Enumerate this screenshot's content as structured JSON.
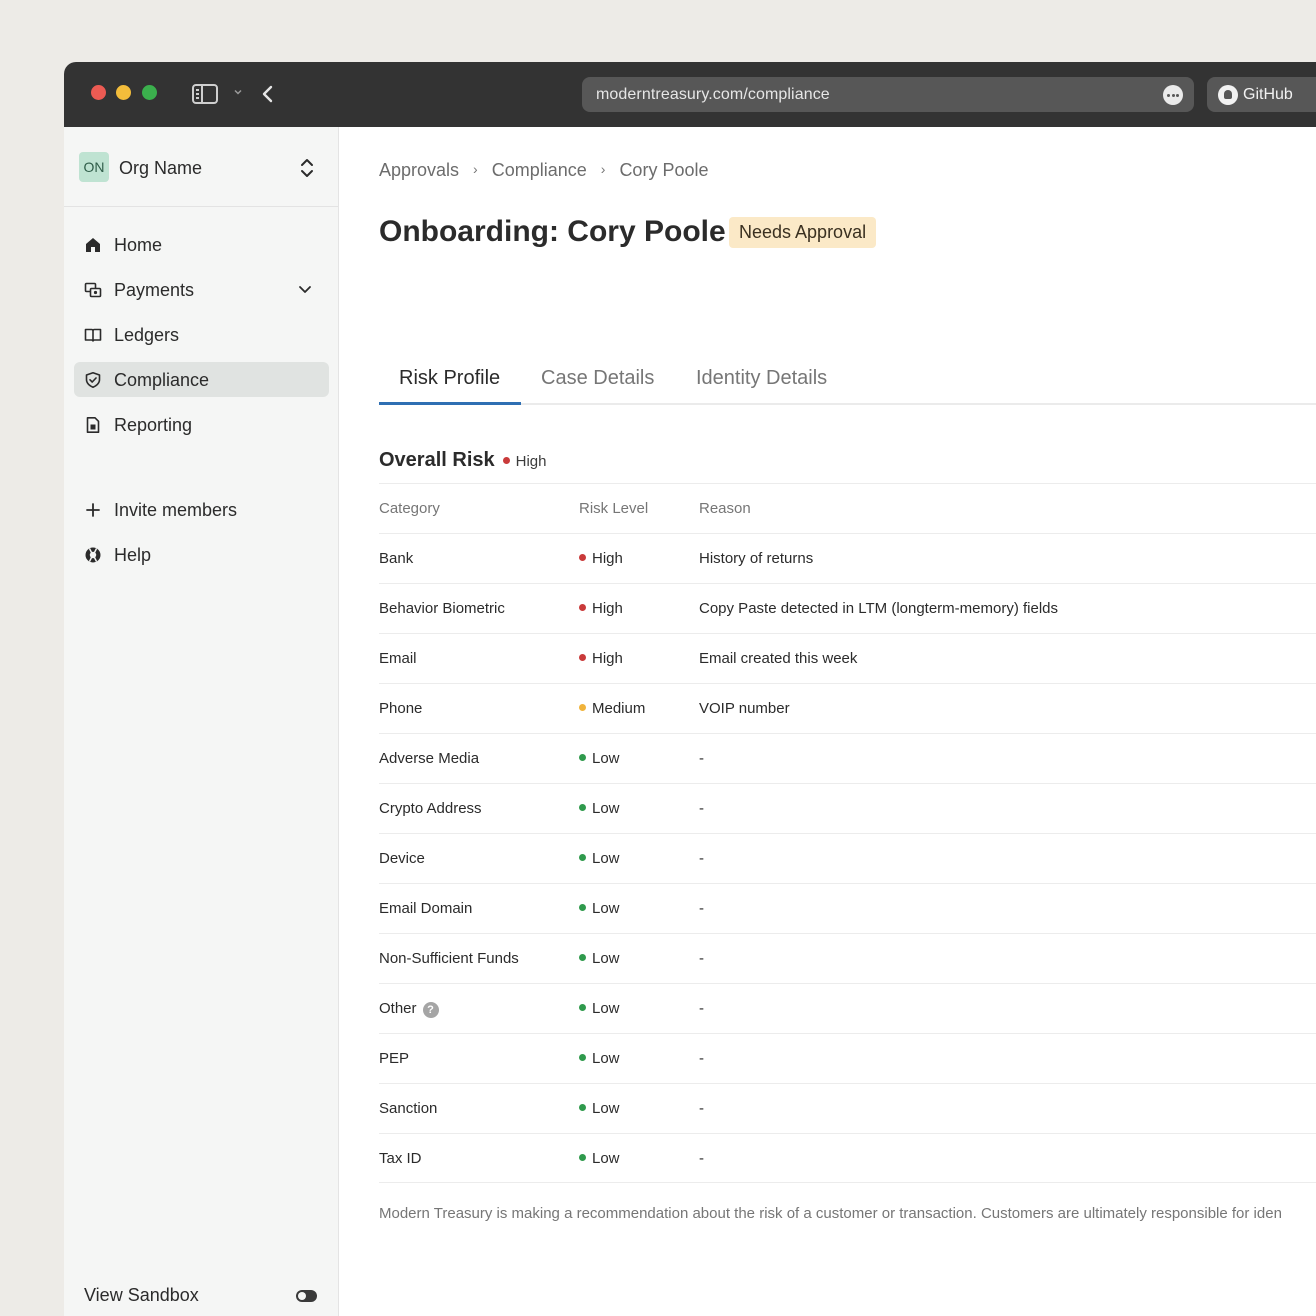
{
  "browser": {
    "url": "moderntreasury.com/compliance",
    "github_label": "GitHub"
  },
  "sidebar": {
    "org_initials": "ON",
    "org_name": "Org Name",
    "nav": [
      {
        "label": "Home",
        "icon": "home-icon"
      },
      {
        "label": "Payments",
        "icon": "payments-icon"
      },
      {
        "label": "Ledgers",
        "icon": "book-icon"
      },
      {
        "label": "Compliance",
        "icon": "shield-icon",
        "active": true
      },
      {
        "label": "Reporting",
        "icon": "report-icon"
      }
    ],
    "secondary": [
      {
        "label": "Invite members",
        "icon": "plus-icon"
      },
      {
        "label": "Help",
        "icon": "lifebuoy-icon"
      }
    ],
    "sandbox_label": "View Sandbox"
  },
  "breadcrumb": [
    "Approvals",
    "Compliance",
    "Cory Poole"
  ],
  "page": {
    "title": "Onboarding: Cory Poole",
    "status": "Needs Approval"
  },
  "tabs": [
    "Risk Profile",
    "Case Details",
    "Identity Details"
  ],
  "overall": {
    "title": "Overall Risk",
    "level": "High"
  },
  "table": {
    "headers": [
      "Category",
      "Risk Level",
      "Reason"
    ],
    "rows": [
      {
        "category": "Bank",
        "level": "High",
        "reason": "History of returns"
      },
      {
        "category": "Behavior Biometric",
        "level": "High",
        "reason": "Copy Paste detected in LTM (longterm-memory) fields"
      },
      {
        "category": "Email",
        "level": "High",
        "reason": "Email created this week"
      },
      {
        "category": "Phone",
        "level": "Medium",
        "reason": "VOIP number"
      },
      {
        "category": "Adverse Media",
        "level": "Low",
        "reason": "-"
      },
      {
        "category": "Crypto Address",
        "level": "Low",
        "reason": "-"
      },
      {
        "category": "Device",
        "level": "Low",
        "reason": "-"
      },
      {
        "category": "Email Domain",
        "level": "Low",
        "reason": "-"
      },
      {
        "category": "Non-Sufficient Funds",
        "level": "Low",
        "reason": "-"
      },
      {
        "category": "Other",
        "level": "Low",
        "reason": "-"
      },
      {
        "category": "PEP",
        "level": "Low",
        "reason": "-"
      },
      {
        "category": "Sanction",
        "level": "Low",
        "reason": "-"
      },
      {
        "category": "Tax ID",
        "level": "Low",
        "reason": "-"
      }
    ]
  },
  "disclaimer": "Modern Treasury is making a recommendation about the risk of a customer or transaction. Customers are ultimately responsible for iden",
  "colors": {
    "high": "#c93a3a",
    "medium": "#f0b33b",
    "low": "#2f9a4c",
    "accent": "#2f6fb3",
    "badge_bg": "#fbe9c7"
  }
}
